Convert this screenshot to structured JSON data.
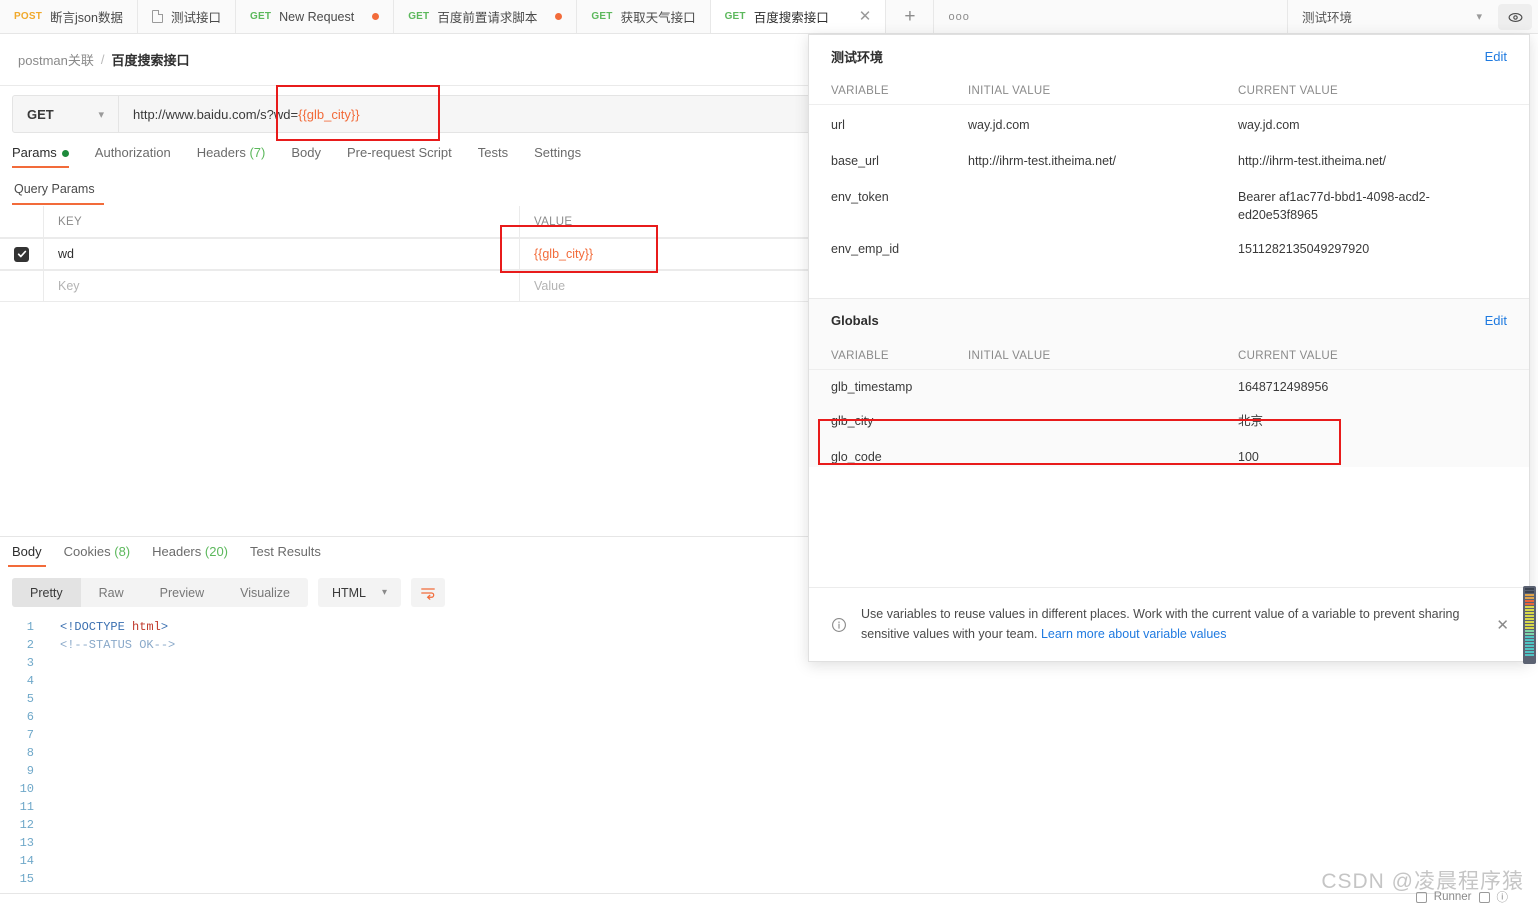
{
  "tabbar": {
    "tabs": [
      {
        "method": "POST",
        "label": "断言json数据",
        "unsaved": false,
        "active": false,
        "icon": ""
      },
      {
        "method": "",
        "label": "测试接口",
        "unsaved": false,
        "active": false,
        "icon": "document-icon"
      },
      {
        "method": "GET",
        "label": "New Request",
        "unsaved": true,
        "active": false,
        "icon": ""
      },
      {
        "method": "GET",
        "label": "百度前置请求脚本",
        "unsaved": true,
        "active": false,
        "icon": ""
      },
      {
        "method": "GET",
        "label": "获取天气接口",
        "unsaved": false,
        "active": false,
        "icon": ""
      },
      {
        "method": "GET",
        "label": "百度搜索接口",
        "unsaved": false,
        "active": true,
        "icon": ""
      }
    ],
    "new_tab_label": "+",
    "more_label": "ooo",
    "environment_selected": "测试环境",
    "eye_icon": "eye-icon"
  },
  "breadcrumb": {
    "parent": "postman关联",
    "separator": "/",
    "current": "百度搜索接口"
  },
  "request": {
    "method": "GET",
    "url_prefix": "http://www.baidu.com/s?wd=",
    "url_variable": "{{glb_city}}",
    "tabs": [
      {
        "label": "Params",
        "dot": true,
        "active": true,
        "count": ""
      },
      {
        "label": "Authorization",
        "dot": false,
        "active": false,
        "count": ""
      },
      {
        "label": "Headers",
        "dot": false,
        "active": false,
        "count": "(7)"
      },
      {
        "label": "Body",
        "dot": false,
        "active": false,
        "count": ""
      },
      {
        "label": "Pre-request Script",
        "dot": false,
        "active": false,
        "count": ""
      },
      {
        "label": "Tests",
        "dot": false,
        "active": false,
        "count": ""
      },
      {
        "label": "Settings",
        "dot": false,
        "active": false,
        "count": ""
      }
    ],
    "query_params_title": "Query Params",
    "table": {
      "headers": {
        "key": "KEY",
        "value": "VALUE"
      },
      "rows": [
        {
          "checked": true,
          "key": "wd",
          "value": "{{glb_city}}",
          "is_variable": true,
          "placeholder_row": false
        },
        {
          "checked": false,
          "key": "Key",
          "value": "Value",
          "is_variable": false,
          "placeholder_row": true
        }
      ]
    }
  },
  "response": {
    "tabs": [
      {
        "label": "Body",
        "count": "",
        "active": true
      },
      {
        "label": "Cookies",
        "count": "(8)",
        "active": false
      },
      {
        "label": "Headers",
        "count": "(20)",
        "active": false
      },
      {
        "label": "Test Results",
        "count": "",
        "active": false
      }
    ],
    "view_modes": [
      "Pretty",
      "Raw",
      "Preview",
      "Visualize"
    ],
    "view_mode_active": "Pretty",
    "format": "HTML",
    "wrap_icon": "text-wrap-icon",
    "code_lines": [
      {
        "n": "1",
        "pre": "<!DOCTYPE ",
        "em": "html",
        "post": ">",
        "type": "doctype"
      },
      {
        "n": "2",
        "pre": "<!--STATUS OK-->",
        "em": "",
        "post": "",
        "type": "comment"
      },
      {
        "n": "3",
        "pre": "",
        "em": "",
        "post": "",
        "type": "empty"
      },
      {
        "n": "4",
        "pre": "",
        "em": "",
        "post": "",
        "type": "empty"
      },
      {
        "n": "5",
        "pre": "",
        "em": "",
        "post": "",
        "type": "empty"
      },
      {
        "n": "6",
        "pre": "",
        "em": "",
        "post": "",
        "type": "empty"
      },
      {
        "n": "7",
        "pre": "",
        "em": "",
        "post": "",
        "type": "empty"
      },
      {
        "n": "8",
        "pre": "",
        "em": "",
        "post": "",
        "type": "empty"
      },
      {
        "n": "9",
        "pre": "",
        "em": "",
        "post": "",
        "type": "empty"
      },
      {
        "n": "10",
        "pre": "",
        "em": "",
        "post": "",
        "type": "empty"
      },
      {
        "n": "11",
        "pre": "",
        "em": "",
        "post": "",
        "type": "empty"
      },
      {
        "n": "12",
        "pre": "",
        "em": "",
        "post": "",
        "type": "empty"
      },
      {
        "n": "13",
        "pre": "",
        "em": "",
        "post": "",
        "type": "empty"
      },
      {
        "n": "14",
        "pre": "",
        "em": "",
        "post": "",
        "type": "empty"
      },
      {
        "n": "15",
        "pre": "",
        "em": "",
        "post": "",
        "type": "empty"
      }
    ]
  },
  "env_panel": {
    "environment": {
      "title": "测试环境",
      "edit_label": "Edit",
      "columns": {
        "variable": "VARIABLE",
        "initial": "INITIAL VALUE",
        "current": "CURRENT VALUE"
      },
      "rows": [
        {
          "variable": "url",
          "initial": "way.jd.com",
          "current": "way.jd.com"
        },
        {
          "variable": "base_url",
          "initial": "http://ihrm-test.itheima.net/",
          "current": "http://ihrm-test.itheima.net/"
        },
        {
          "variable": "env_token",
          "initial": "",
          "current": "Bearer af1ac77d-bbd1-4098-acd2-ed20e53f8965"
        },
        {
          "variable": "env_emp_id",
          "initial": "",
          "current": "1511282135049297920"
        }
      ]
    },
    "globals": {
      "title": "Globals",
      "edit_label": "Edit",
      "columns": {
        "variable": "VARIABLE",
        "initial": "INITIAL VALUE",
        "current": "CURRENT VALUE"
      },
      "rows": [
        {
          "variable": "glb_timestamp",
          "initial": "",
          "current": "1648712498956"
        },
        {
          "variable": "glb_city",
          "initial": "",
          "current": "北京"
        },
        {
          "variable": "glo_code",
          "initial": "",
          "current": "100"
        }
      ]
    },
    "banner": {
      "icon": "info-icon",
      "text": "Use variables to reuse values in different places. Work with the current value of a variable to prevent sharing sensitive values with your team.",
      "link": "Learn more about variable values",
      "close_icon": "close-icon"
    }
  },
  "statusbar": {
    "runner_label": "Runner",
    "watermark": "CSDN @凌晨程序猿"
  },
  "colors": {
    "accent_orange": "#f26b3a",
    "method_get_green": "#5cb85c",
    "method_post_orange": "#f0a92b",
    "link_blue": "#1f7ae0",
    "annotation_red": "#e81b1b",
    "variable_orange": "#f26b3a"
  }
}
